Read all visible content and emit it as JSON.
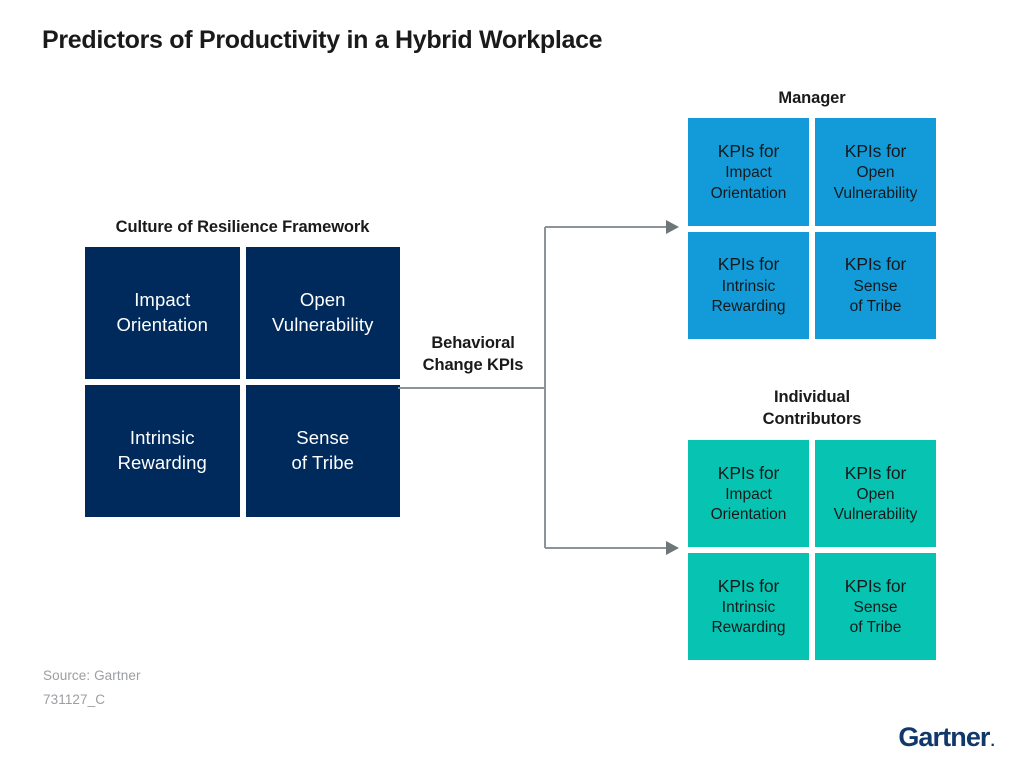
{
  "slide": {
    "title": "Predictors of Productivity in a Hybrid Workplace",
    "background_color": "#ffffff"
  },
  "colors": {
    "navy": "#002a5c",
    "blue": "#129bd8",
    "teal": "#06c4b1",
    "title_text": "#1a1a1a",
    "footer_text": "#9b9ea2",
    "connector_line": "#8d9497",
    "logo_navy": "#11386b"
  },
  "framework": {
    "heading": "Culture of Resilience Framework",
    "cells": [
      {
        "line1": "Impact",
        "line2": "Orientation"
      },
      {
        "line1": "Open",
        "line2": "Vulnerability"
      },
      {
        "line1": "Intrinsic",
        "line2": "Rewarding"
      },
      {
        "line1": "Sense",
        "line2": "of Tribe"
      }
    ]
  },
  "connector": {
    "label_line1": "Behavioral",
    "label_line2": "Change KPIs",
    "arrow_count": 2,
    "arrow_direction": "right"
  },
  "kpi_groups": [
    {
      "id": "manager",
      "heading_line1": "Manager",
      "heading_line2": "",
      "color": "#129bd8",
      "cells": [
        {
          "head": "KPIs for",
          "sub1": "Impact",
          "sub2": "Orientation"
        },
        {
          "head": "KPIs for",
          "sub1": "Open",
          "sub2": "Vulnerability"
        },
        {
          "head": "KPIs for",
          "sub1": "Intrinsic",
          "sub2": "Rewarding"
        },
        {
          "head": "KPIs for",
          "sub1": "Sense",
          "sub2": "of Tribe"
        }
      ]
    },
    {
      "id": "individual-contributors",
      "heading_line1": "Individual",
      "heading_line2": "Contributors",
      "color": "#06c4b1",
      "cells": [
        {
          "head": "KPIs for",
          "sub1": "Impact",
          "sub2": "Orientation"
        },
        {
          "head": "KPIs for",
          "sub1": "Open",
          "sub2": "Vulnerability"
        },
        {
          "head": "KPIs for",
          "sub1": "Intrinsic",
          "sub2": "Rewarding"
        },
        {
          "head": "KPIs for",
          "sub1": "Sense",
          "sub2": "of Tribe"
        }
      ]
    }
  ],
  "footer": {
    "source": "Source: Gartner",
    "chart_id": "731127_C"
  },
  "logo": {
    "word": "Gartner",
    "mark": "."
  }
}
